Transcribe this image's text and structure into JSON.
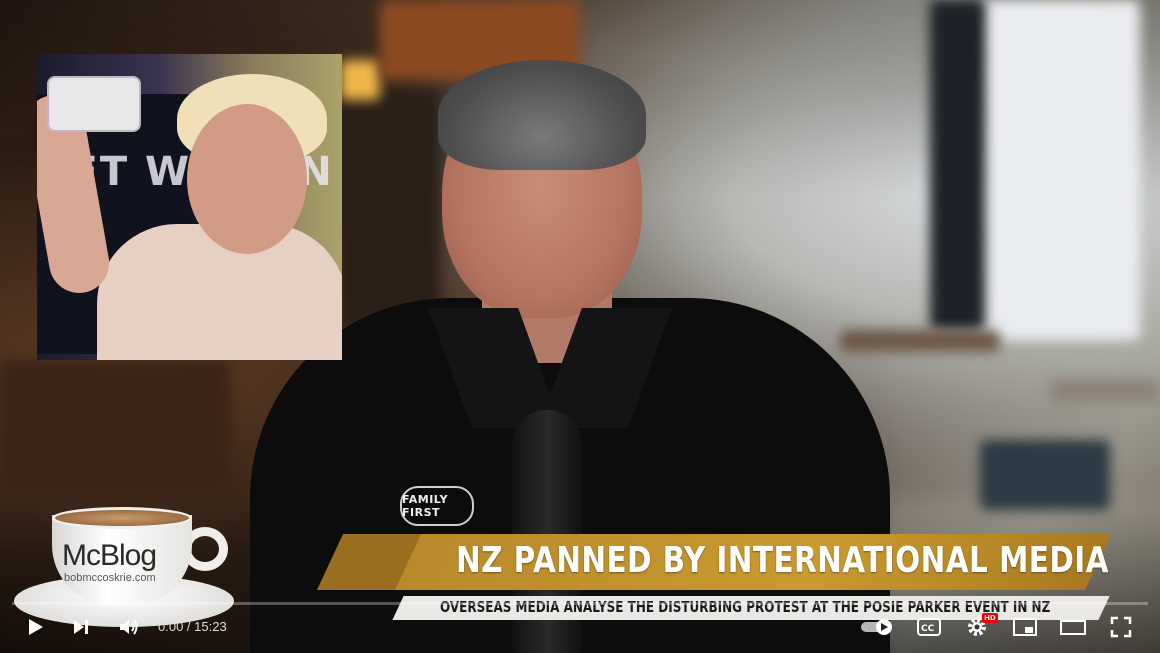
{
  "video": {
    "headline": "NZ PANNED BY INTERNATIONAL MEDIA",
    "subheadline": "OVERSEAS MEDIA ANALYSE THE DISTURBING PROTEST AT THE POSIE PARKER EVENT IN NZ",
    "mug_brand": "McBlog",
    "mug_url": "bobmccoskrie.com",
    "shirt_logo": "FAMILY FIRST",
    "inset_banner_text": "LET WOMEN"
  },
  "player": {
    "current_time": "0:00",
    "separator": " / ",
    "duration": "15:23",
    "progress_fraction": 0.0,
    "hd_badge": "HD",
    "accent_color": "#ff0000",
    "icons": {
      "play": "play-icon",
      "next": "next-icon",
      "volume": "volume-icon",
      "autoplay": "autoplay-toggle-icon",
      "captions": "captions-icon",
      "settings": "settings-gear-icon",
      "miniplayer": "miniplayer-icon",
      "theater": "theater-mode-icon",
      "fullscreen": "fullscreen-icon"
    }
  }
}
